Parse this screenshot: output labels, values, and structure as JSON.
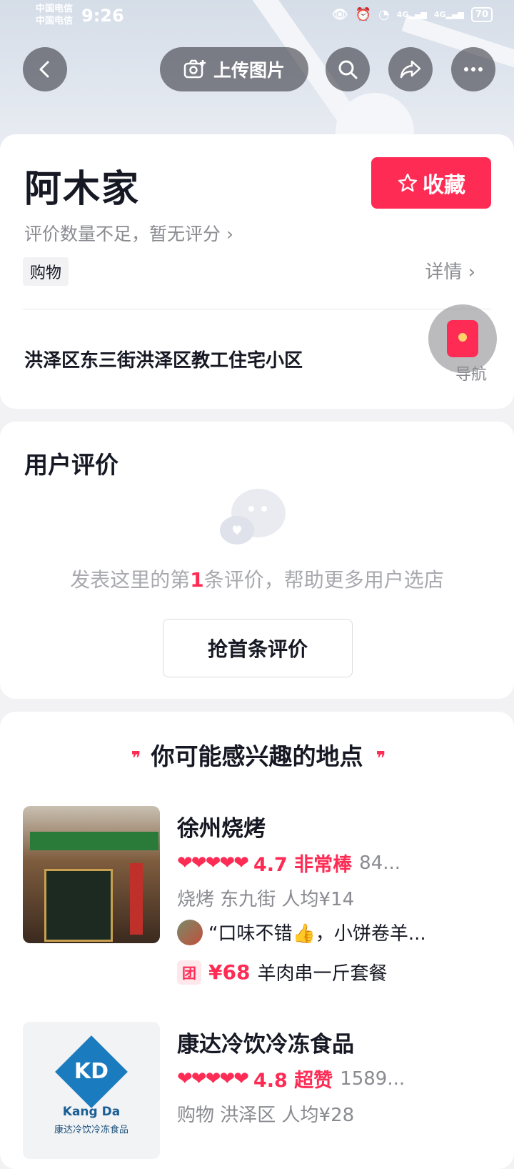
{
  "status_bar": {
    "carrier1": "中国电信",
    "carrier2": "中国电信",
    "time": "9:26",
    "signal1": "4G",
    "signal2": "4G",
    "battery": "70"
  },
  "header": {
    "upload_label": "上传图片"
  },
  "shop": {
    "name": "阿木家",
    "favorite_label": "收藏",
    "rating_note": "评价数量不足，暂无评分",
    "category": "购物",
    "details_label": "详情",
    "address": "洪泽区东三街洪泽区教工住宅小区",
    "nav_label": "导航"
  },
  "reviews": {
    "title": "用户评价",
    "empty_prefix": "发表这里的第",
    "empty_num": "1",
    "empty_suffix": "条评价，帮助更多用户选店",
    "first_review_button": "抢首条评价"
  },
  "recommend": {
    "title": "你可能感兴趣的地点",
    "items": [
      {
        "name": "徐州烧烤",
        "hearts": "❤❤❤❤❤",
        "score": "4.7 非常棒",
        "count": "84...",
        "meta": "烧烤 东九街 人均¥14",
        "review": "“口味不错👍，小饼卷羊...",
        "deal_icon": "团",
        "deal_price": "¥68",
        "deal_name": "羊肉串一斤套餐"
      },
      {
        "name": "康达冷饮冷冻食品",
        "hearts": "❤❤❤❤❤",
        "score": "4.8 超赞",
        "count": "1589...",
        "meta": "购物 洪泽区 人均¥28",
        "logo_text": "KD",
        "logo_en": "Kang  Da",
        "logo_cn": "康达冷饮冷冻食品"
      }
    ]
  },
  "colors": {
    "accent": "#fe2c55",
    "secondary_text": "#8a8b91"
  }
}
